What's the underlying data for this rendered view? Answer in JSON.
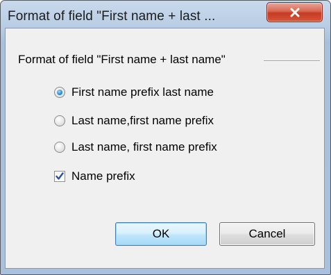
{
  "window": {
    "title": "Format of field \"First name + last ...",
    "close_icon": "close-icon"
  },
  "group": {
    "title": "Format of field \"First name + last name\""
  },
  "options": [
    {
      "label": "First name prefix last name",
      "checked": true
    },
    {
      "label": "Last name,first name prefix",
      "checked": false
    },
    {
      "label": "Last name, first name prefix",
      "checked": false
    }
  ],
  "name_prefix": {
    "label": "Name prefix",
    "checked": true
  },
  "buttons": {
    "ok_label": "OK",
    "cancel_label": "Cancel"
  },
  "colors": {
    "titlebar": "#b7cce3",
    "close_button": "#c73a22",
    "client_background": "#f0f0f0",
    "radio_selected": "#2f8fd6",
    "checkmark": "#2a4fa8"
  }
}
